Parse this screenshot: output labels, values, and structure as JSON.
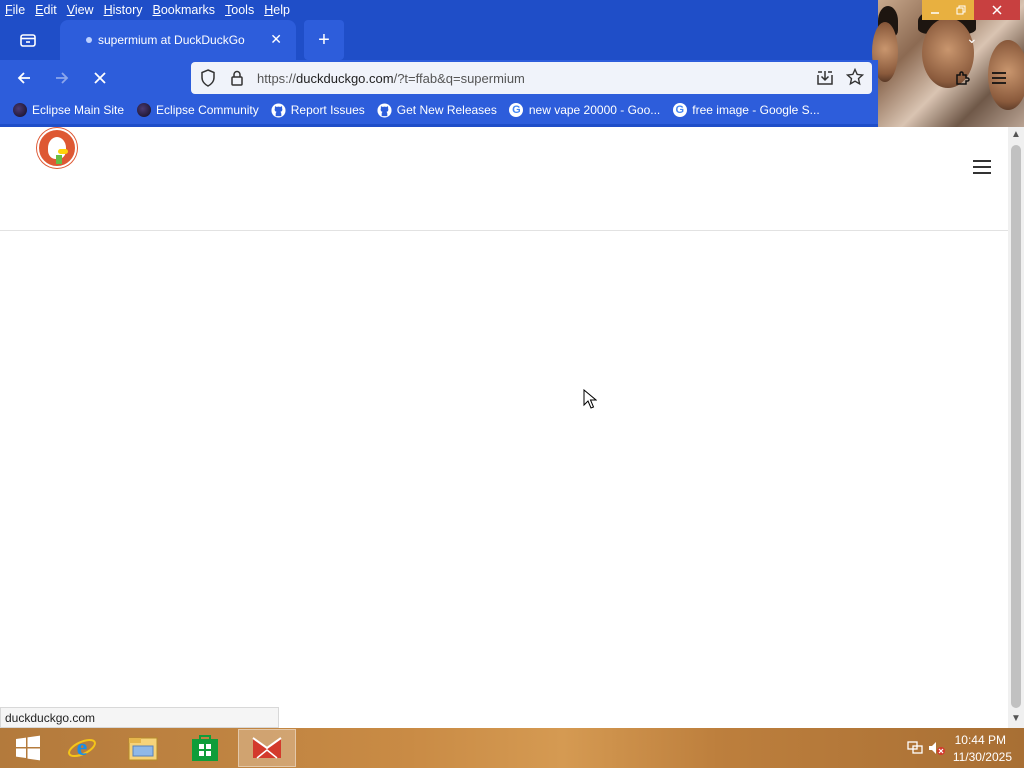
{
  "menubar": {
    "items": [
      "File",
      "Edit",
      "View",
      "History",
      "Bookmarks",
      "Tools",
      "Help"
    ],
    "underlines": [
      "F",
      "E",
      "V",
      "H",
      "B",
      "T",
      "H"
    ]
  },
  "tab": {
    "title": "supermium at DuckDuckGo"
  },
  "urlbar": {
    "scheme": "https://",
    "host": "duckduckgo.com",
    "path": "/?t=ffab&q=supermium"
  },
  "bookmarks": [
    {
      "label": "Eclipse Main Site",
      "icon": "eclipse-icon"
    },
    {
      "label": "Eclipse Community",
      "icon": "eclipse-icon"
    },
    {
      "label": "Report Issues",
      "icon": "github-icon"
    },
    {
      "label": "Get New Releases",
      "icon": "github-icon"
    },
    {
      "label": "new vape 20000 - Goo...",
      "icon": "google-icon"
    },
    {
      "label": "free image - Google S...",
      "icon": "google-icon"
    }
  ],
  "status": {
    "url": "duckduckgo.com"
  },
  "taskbar": {
    "time": "10:44 PM",
    "date": "11/30/2025"
  },
  "colors": {
    "chrome": "#1f4ec8",
    "toolbar": "#2d5ddb",
    "ddg_orange": "#de5833"
  }
}
